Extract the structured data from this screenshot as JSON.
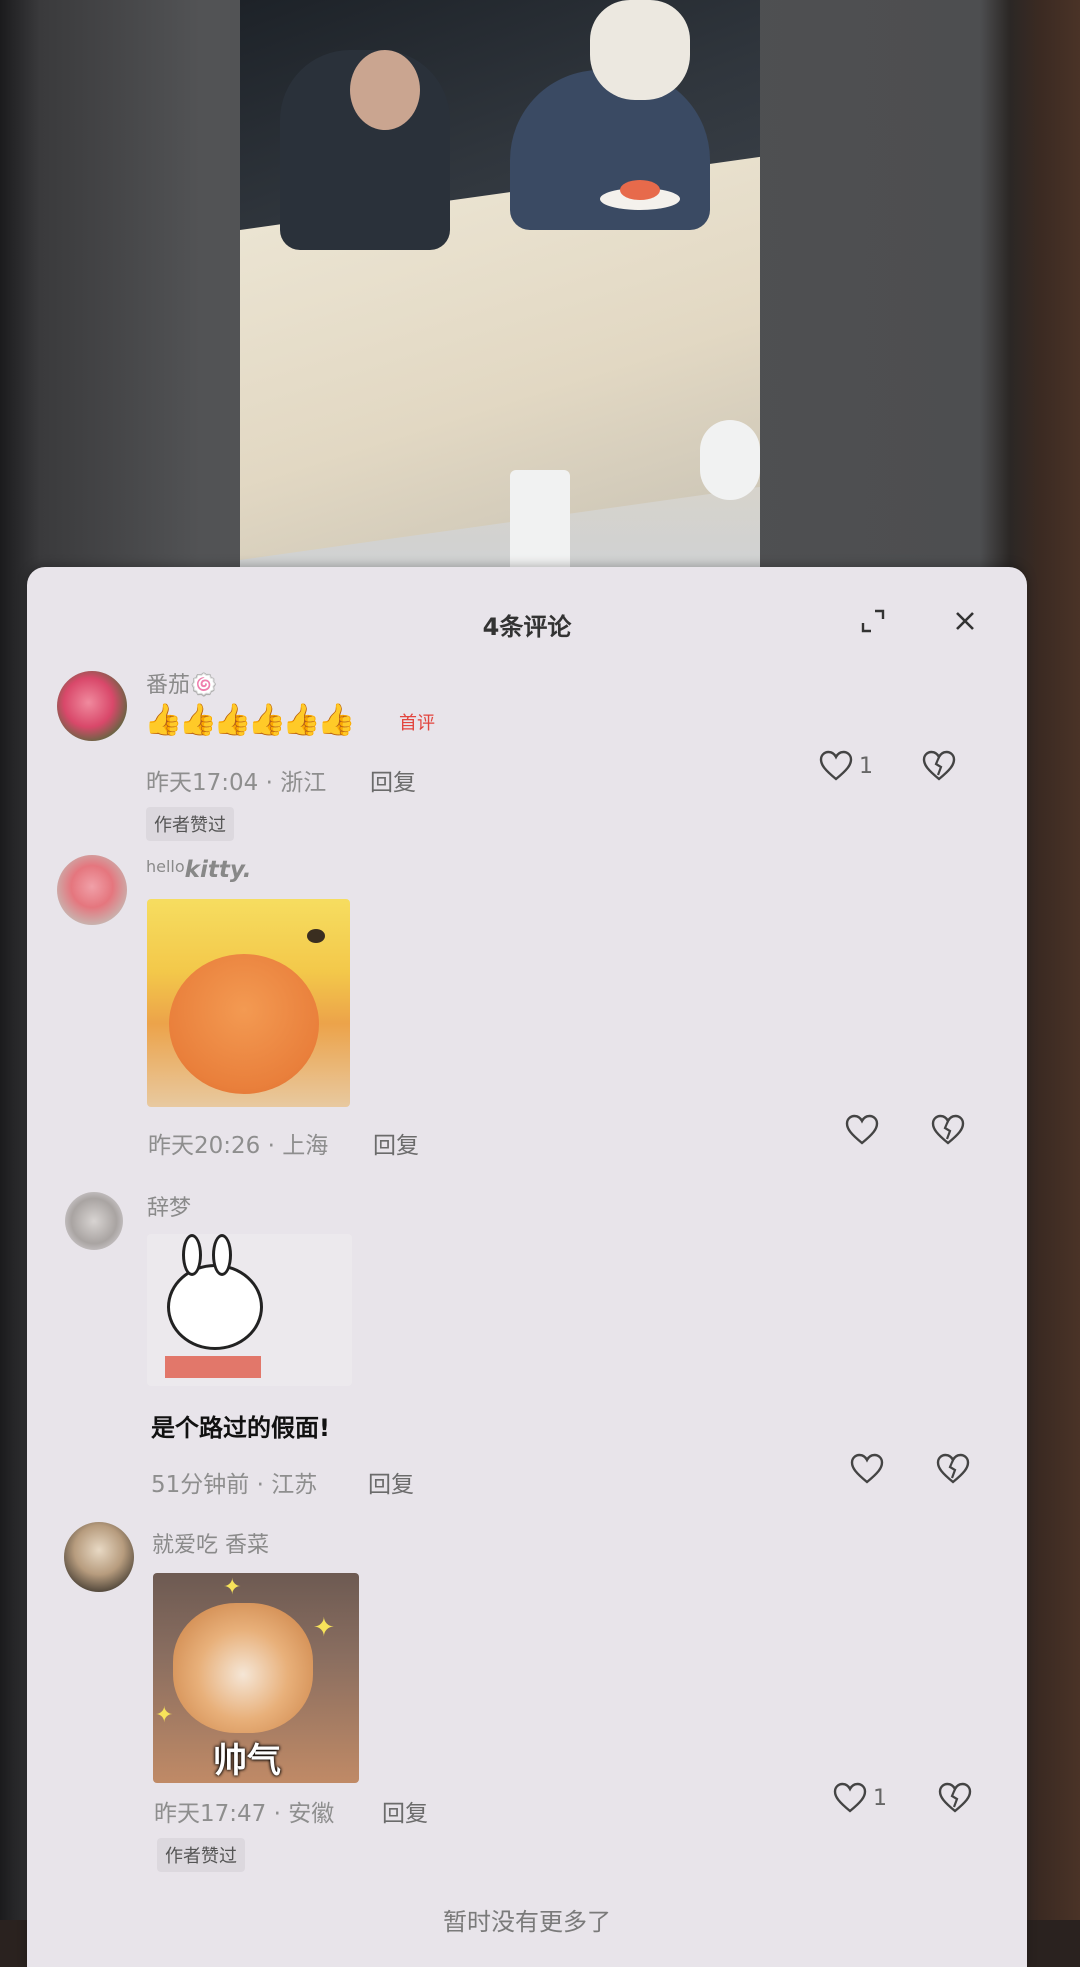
{
  "sheet": {
    "title": "4条评论",
    "footer": "暂时没有更多了"
  },
  "comments": [
    {
      "username": "番茄🍥",
      "text": "👍👍👍👍👍👍",
      "first_tag": "首评",
      "time_location": "昨天17:04 · 浙江",
      "reply": "回复",
      "likes": "1",
      "author_badge": "作者赞过"
    },
    {
      "username": "hellokitty.",
      "username_prefix": "hello",
      "username_main": "kitty.",
      "time_location": "昨天20:26 · 上海",
      "reply": "回复",
      "likes": ""
    },
    {
      "username": "辞梦",
      "sticker_caption": "是个路过的假面!",
      "time_location": "51分钟前 · 江苏",
      "reply": "回复",
      "likes": ""
    },
    {
      "username": "就爱吃 香菜",
      "sticker_caption": "帅气",
      "time_location": "昨天17:47 · 安徽",
      "reply": "回复",
      "likes": "1",
      "author_badge": "作者赞过"
    }
  ],
  "icons": {
    "expand": "expand-icon",
    "close": "close-icon",
    "like": "heart-icon",
    "dislike": "broken-heart-icon"
  },
  "colors": {
    "sheet_bg": "#e8e4ea",
    "first_tag": "#e2453e",
    "meta_text": "#8e8e8e"
  }
}
